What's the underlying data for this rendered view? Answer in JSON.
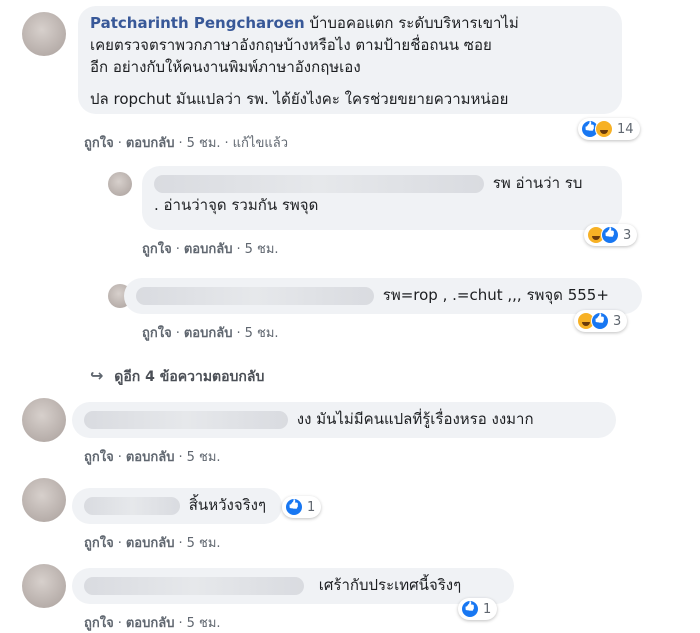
{
  "comments": [
    {
      "author": "Patcharinth Pengcharoen",
      "text_line1": " บ้าบอคอแตก ระดับบริหารเขาไม่",
      "text_line2": "เคยตรวจตราพวกภาษาอังกฤษบ้างหรือไง ตามป้ายชื่อถนน ซอย",
      "text_line3": "อีก อย่างกับให้คนงานพิมพ์ภาษาอังกฤษเอง",
      "text_line4": "ปล ropchut มันแปลว่า รพ. ได้ยังไงคะ ใครช่วยขยายความหน่อย",
      "like": "ถูกใจ",
      "reply": "ตอบกลับ",
      "time": "5 ชม.",
      "edited": "แก้ไขแล้ว",
      "reactions": "14"
    },
    {
      "text_line1": "รพ อ่านว่า รบ",
      "text_line2": ". อ่านว่าจุด รวมกัน รพจุด",
      "like": "ถูกใจ",
      "reply": "ตอบกลับ",
      "time": "5 ชม.",
      "reactions": "3"
    },
    {
      "text": "รพ=rop , .=chut ,,, รพจุด 555+",
      "like": "ถูกใจ",
      "reply": "ตอบกลับ",
      "time": "5 ชม.",
      "reactions": "3"
    },
    {
      "more_replies": "ดูอีก 4 ข้อความตอบกลับ"
    },
    {
      "text": "งง มันไม่มีคนแปลที่รู้เรื่องหรอ งงมาก",
      "like": "ถูกใจ",
      "reply": "ตอบกลับ",
      "time": "5 ชม."
    },
    {
      "text": "สิ้นหวังจริงๆ",
      "like": "ถูกใจ",
      "reply": "ตอบกลับ",
      "time": "5 ชม.",
      "reactions": "1"
    },
    {
      "text": "เศร้ากับประเทศนี้จริงๆ",
      "like": "ถูกใจ",
      "reply": "ตอบกลับ",
      "time": "5 ชม.",
      "reactions": "1"
    }
  ],
  "colors": {
    "link": "#385898",
    "bubble": "#f0f2f5",
    "meta": "#606770",
    "like": "#1877f2",
    "haha": "#f7b125"
  }
}
